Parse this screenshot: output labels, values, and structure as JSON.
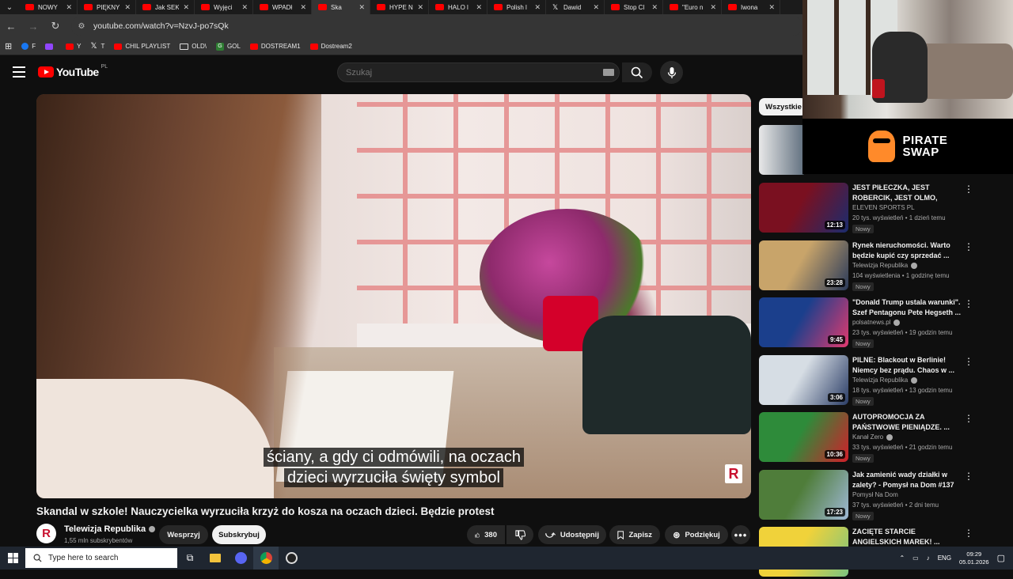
{
  "browser": {
    "tabs": [
      {
        "title": "NOWY",
        "active": false,
        "favicon": "youtube"
      },
      {
        "title": "PIĘKNY",
        "active": false,
        "favicon": "youtube"
      },
      {
        "title": "Jak SEK",
        "active": false,
        "favicon": "youtube"
      },
      {
        "title": "Wyjęci",
        "active": false,
        "favicon": "youtube"
      },
      {
        "title": "WPADł",
        "active": false,
        "favicon": "youtube"
      },
      {
        "title": "Ska",
        "active": true,
        "favicon": "youtube"
      },
      {
        "title": "HYPE N",
        "active": false,
        "favicon": "youtube"
      },
      {
        "title": "HALO l",
        "active": false,
        "favicon": "youtube"
      },
      {
        "title": "Polish l",
        "active": false,
        "favicon": "youtube"
      },
      {
        "title": "Dawid",
        "active": false,
        "favicon": "x"
      },
      {
        "title": "Stop Cl",
        "active": false,
        "favicon": "youtube"
      },
      {
        "title": "\"Euro n",
        "active": false,
        "favicon": "youtube"
      },
      {
        "title": "Iwona",
        "active": false,
        "favicon": "youtube"
      }
    ],
    "url": "youtube.com/watch?v=NzvJ-po7sQk",
    "bookmarks": [
      {
        "label": "F",
        "icon": "facebook"
      },
      {
        "label": "",
        "icon": "twitch"
      },
      {
        "label": "Y",
        "icon": "youtube"
      },
      {
        "label": "T",
        "icon": "x"
      },
      {
        "label": "CHIL PLAYLIST",
        "icon": "youtube"
      },
      {
        "label": "OLD\\",
        "icon": "folder"
      },
      {
        "label": "GOL",
        "icon": "g"
      },
      {
        "label": "DOSTREAM1",
        "icon": "youtube"
      },
      {
        "label": "Dostream2",
        "icon": "youtube"
      }
    ]
  },
  "youtube": {
    "logo_text": "YouTube",
    "region": "PL",
    "search_placeholder": "Szukaj"
  },
  "video": {
    "caption_line1": "ściany, a gdy ci odmówili, na oczach",
    "caption_line2": "dzieci wyrzuciła święty symbol",
    "watermark": "R",
    "title": "Skandal w szkole! Nauczycielka wyrzuciła krzyż do kosza na oczach dzieci. Będzie protest"
  },
  "channel": {
    "avatar_letter": "R",
    "name": "Telewizja Republika",
    "subscribers": "1,55 mln subskrybentów",
    "support_label": "Wesprzyj",
    "subscribe_label": "Subskrybuj"
  },
  "actions": {
    "likes": "380",
    "share_label": "Udostępnij",
    "save_label": "Zapisz",
    "thanks_label": "Podziękuj"
  },
  "sidebar": {
    "chip_all": "Wszystkie",
    "recommendations": [
      {
        "title": "JEST PIŁECZKA, JEST ROBERCIK, JEST OLMO, DERB...",
        "channel": "ELEVEN SPORTS PL",
        "verified": false,
        "meta": "20 tys. wyświetleń • 1 dzień temu",
        "badge": "Nowy",
        "duration": "12:13",
        "thumb_colors": [
          "#7a1020",
          "#1a2c6e"
        ]
      },
      {
        "title": "Rynek nieruchomości. Warto będzie kupić czy sprzedać ...",
        "channel": "Telewizja Republika",
        "verified": true,
        "meta": "104 wyświetlenia • 1 godzinę temu",
        "badge": "Nowy",
        "duration": "23:28",
        "thumb_colors": [
          "#c8a46a",
          "#2a3a5a"
        ]
      },
      {
        "title": "\"Donald Trump ustala warunki\". Szef Pentagonu Pete Hegseth ...",
        "channel": "polsatnews.pl",
        "verified": true,
        "meta": "23 tys. wyświetleń • 19 godzin temu",
        "badge": "Nowy",
        "duration": "9:45",
        "thumb_colors": [
          "#1b3f8c",
          "#e23a6f"
        ]
      },
      {
        "title": "PILNE: Blackout w Berlinie! Niemcy bez prądu. Chaos w ...",
        "channel": "Telewizja Republika",
        "verified": true,
        "meta": "18 tys. wyświetleń • 13 godzin temu",
        "badge": "Nowy",
        "duration": "3:06",
        "thumb_colors": [
          "#d6dde4",
          "#2b3d66"
        ]
      },
      {
        "title": "AUTOPROMOCJA ZA PAŃSTWOWE PIENIĄDZE. ...",
        "channel": "Kanał Zero",
        "verified": true,
        "meta": "33 tys. wyświetleń • 21 godzin temu",
        "badge": "Nowy",
        "duration": "10:36",
        "thumb_colors": [
          "#2e8b3a",
          "#d11f2a"
        ]
      },
      {
        "title": "Jak zamienić wady działki w zalety? - Pomysł na Dom #137",
        "channel": "Pomysł Na Dom",
        "verified": false,
        "meta": "37 tys. wyświetleń • 2 dni temu",
        "badge": "Nowy",
        "duration": "17:23",
        "thumb_colors": [
          "#4f7d3a",
          "#9fb8d6"
        ]
      },
      {
        "title": "ZACIĘTE STARCIE ANGIELSKICH MAREK! ...",
        "channel": "",
        "verified": false,
        "meta": "",
        "badge": "",
        "duration": "",
        "thumb_colors": [
          "#f0d23a",
          "#7bc47f"
        ]
      }
    ]
  },
  "overlay": {
    "sponsor_line1": "PIRATE",
    "sponsor_line2": "SWAP"
  },
  "taskbar": {
    "search_placeholder": "Type here to search",
    "language": "ENG",
    "time": "09:29",
    "date": "05.01.2026"
  }
}
